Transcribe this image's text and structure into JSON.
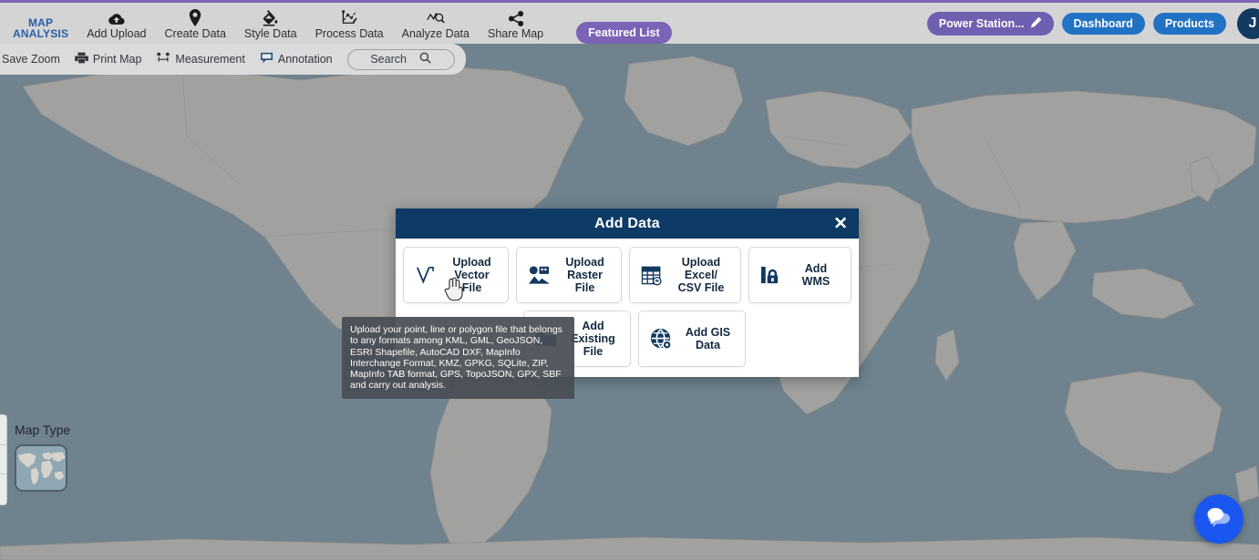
{
  "header": {
    "brand_label": "MAP\nANALYSIS",
    "nav": [
      {
        "label": "Add Upload",
        "icon": "cloud-upload-icon"
      },
      {
        "label": "Create Data",
        "icon": "map-pin-icon"
      },
      {
        "label": "Style Data",
        "icon": "paint-bucket-icon"
      },
      {
        "label": "Process Data",
        "icon": "polyline-edit-icon"
      },
      {
        "label": "Analyze Data",
        "icon": "analyze-chart-icon"
      },
      {
        "label": "Share Map",
        "icon": "share-icon"
      }
    ],
    "featured_list_label": "Featured List",
    "project_label": "Power Station...",
    "project_icon": "pencil-icon",
    "dashboard_label": "Dashboard",
    "products_label": "Products",
    "avatar_initial": "J",
    "accent_violet": "#7b63b5",
    "accent_blue": "#2272c4"
  },
  "toolbar": {
    "save_zoom_label": "Save Zoom",
    "print_map_label": "Print Map",
    "measurement_label": "Measurement",
    "annotation_label": "Annotation",
    "search_label": "Search",
    "search_icon": "search-icon"
  },
  "map_type": {
    "label": "Map Type",
    "thumb_name": "world-map-thumbnail"
  },
  "modal": {
    "title": "Add Data",
    "close_label": "✕",
    "options": [
      {
        "label": "Upload\nVector File",
        "icon": "vector-v-icon"
      },
      {
        "label": "Upload\nRaster File",
        "icon": "raster-image-icon"
      },
      {
        "label": "Upload Excel/\nCSV File",
        "icon": "spreadsheet-icon"
      },
      {
        "label": "Add WMS",
        "icon": "wms-lock-icon"
      },
      {
        "label": "Add Existing File",
        "icon": "folder-icon"
      },
      {
        "label": "Add GIS Data",
        "icon": "globe-icon"
      }
    ],
    "header_color": "#0e3a66"
  },
  "tooltip": {
    "text": "Upload your point, line or polygon file that belongs to any formats among KML, GML, GeoJSON, ESRI Shapefile, AutoCAD DXF, MapInfo Interchange Format, KMZ, GPKG, SQLite, ZIP, MapInfo TAB format, GPS, TopoJSON, GPX, SBF and carry out analysis."
  },
  "chat": {
    "icon": "chat-bubbles-icon",
    "color": "#1a56f0"
  },
  "map": {
    "ocean_color": "#8fa7b2",
    "land_color": "#d6d3cc"
  }
}
